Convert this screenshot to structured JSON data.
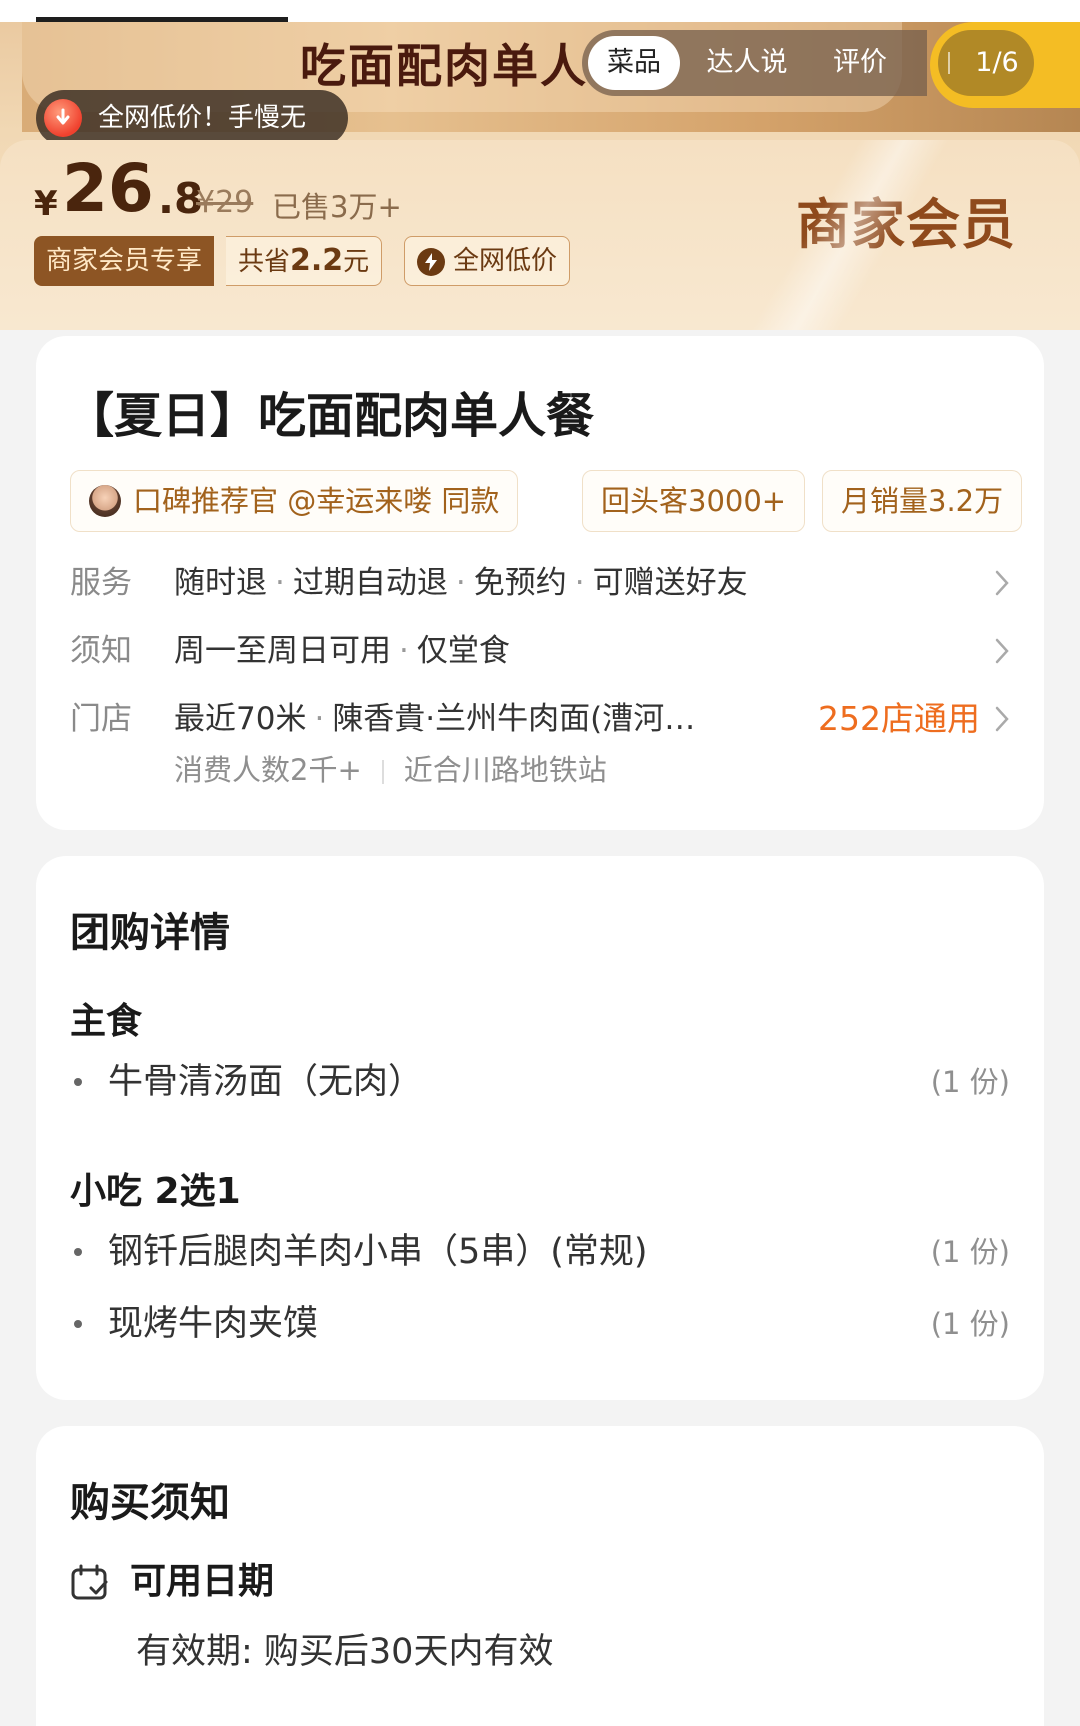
{
  "banner": {
    "title": "吃面配肉单人",
    "tabs": [
      "菜品",
      "达人说",
      "评价"
    ],
    "page_counter": "1/6",
    "flash_deal": "全网低价！手慢无"
  },
  "price": {
    "currency": "¥",
    "integer": "26",
    "decimal": ".8",
    "original": "¥29",
    "sold": "已售3万+",
    "member_tag": "商家会员专享",
    "save_prefix": "共省",
    "save_amount": "2.2",
    "save_suffix": "元",
    "lowest_tag": "全网低价",
    "member_logo": "商家会员"
  },
  "product": {
    "title": "【夏日】吃面配肉单人餐",
    "badges": {
      "recommend": "口碑推荐官 @幸运来喽 同款",
      "repeat": "回头客3000+",
      "monthly": "月销量3.2万"
    },
    "service": {
      "label": "服务",
      "items": [
        "随时退",
        "过期自动退",
        "免预约",
        "可赠送好友"
      ]
    },
    "notice": {
      "label": "须知",
      "items": [
        "周一至周日可用",
        "仅堂食"
      ]
    },
    "store": {
      "label": "门店",
      "distance": "最近70米",
      "name": "陳香貴·兰州牛肉面(漕河…",
      "count": "252店通用",
      "consumers": "消费人数2千+",
      "metro": "近合川路地铁站"
    }
  },
  "detail": {
    "title": "团购详情",
    "groups": [
      {
        "title": "主食",
        "items": [
          {
            "name": "牛骨清汤面（无肉）",
            "qty": "(1 份)"
          }
        ]
      },
      {
        "title": "小吃 2选1",
        "items": [
          {
            "name": "钢钎后腿肉羊肉小串（5串）(常规)",
            "qty": "(1 份)"
          },
          {
            "name": "现烤牛肉夹馍",
            "qty": "(1 份)"
          }
        ]
      }
    ]
  },
  "purchase_notice": {
    "title": "购买须知",
    "date_label": "可用日期",
    "validity": "有效期: 购买后30天内有效"
  },
  "colors": {
    "accent_orange": "#ee6d1f",
    "member_brown": "#8d5524",
    "badge_text": "#a2621c"
  }
}
